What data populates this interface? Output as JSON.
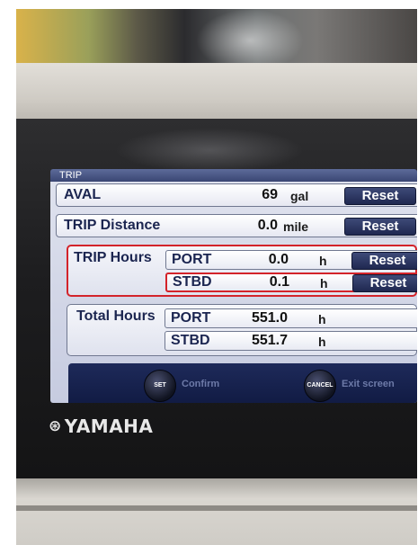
{
  "screen": {
    "title": "TRIP",
    "aval": {
      "label": "AVAL",
      "value": "69",
      "unit": "gal",
      "button": "Reset"
    },
    "trip_distance": {
      "label": "TRIP Distance",
      "value": "0.0",
      "unit": "mile",
      "button": "Reset"
    },
    "trip_hours": {
      "label": "TRIP Hours",
      "rows": [
        {
          "side": "PORT",
          "value": "0.0",
          "unit": "h",
          "button": "Reset"
        },
        {
          "side": "STBD",
          "value": "0.1",
          "unit": "h",
          "button": "Reset"
        }
      ]
    },
    "total_hours": {
      "label": "Total Hours",
      "rows": [
        {
          "side": "PORT",
          "value": "551.0",
          "unit": "h"
        },
        {
          "side": "STBD",
          "value": "551.7",
          "unit": "h"
        }
      ]
    },
    "footer": {
      "set_button": "SET",
      "set_label": "Confirm",
      "cancel_button": "CANCEL",
      "cancel_label": "Exit screen"
    }
  },
  "brand": {
    "logo_text": "YAMAHA",
    "logo_mark": "⊛"
  },
  "colors": {
    "highlight": "#d3232a",
    "button": "#1f2850",
    "screen_bg": "#c6cbe0"
  }
}
